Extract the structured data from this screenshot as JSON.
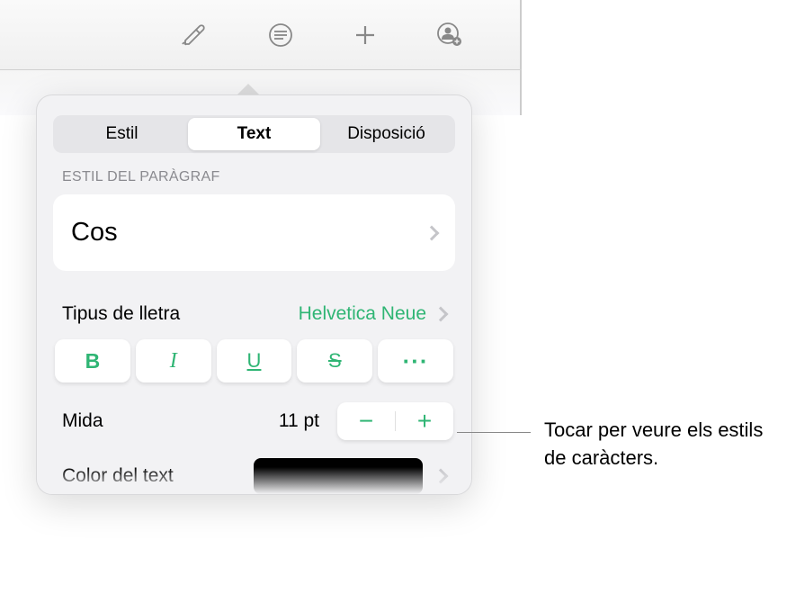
{
  "tabs": {
    "style": "Estil",
    "text": "Text",
    "layout": "Disposició"
  },
  "paragraph": {
    "section_label": "ESTIL DEL PARÀGRAF",
    "style_name": "Cos"
  },
  "font": {
    "label": "Tipus de lletra",
    "value": "Helvetica Neue"
  },
  "format_buttons": {
    "bold": "B",
    "italic": "I",
    "underline": "U",
    "strike": "S",
    "more": "···"
  },
  "size": {
    "label": "Mida",
    "value": "11 pt",
    "minus": "−",
    "plus": "+"
  },
  "text_color": {
    "label": "Color del text"
  },
  "callout": "Tocar per veure els estils de caràcters."
}
